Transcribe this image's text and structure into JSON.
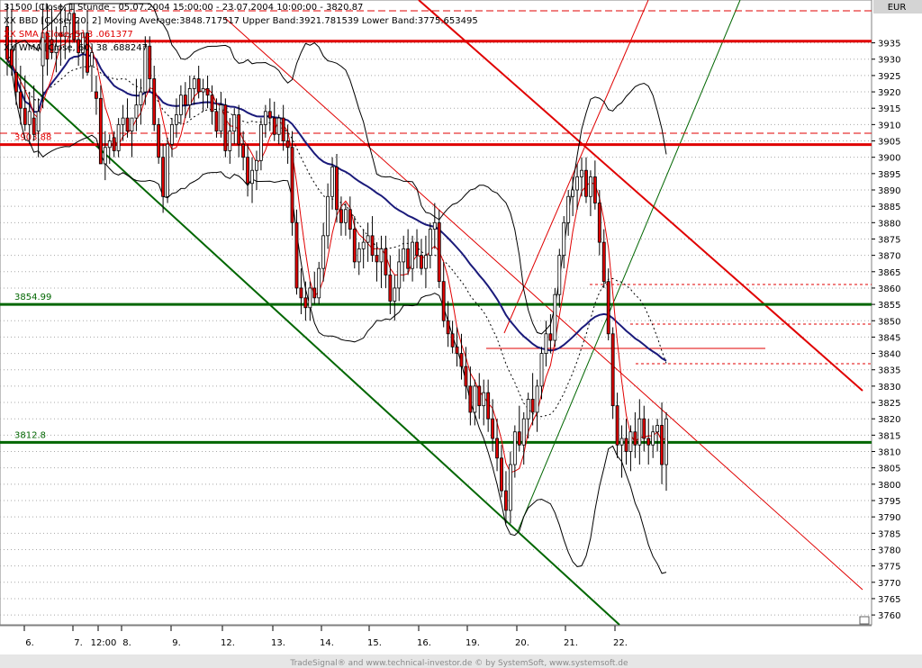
{
  "header": {
    "title_line": "31500 [Close, 1 Stunde - 05.07.2004 15:00:00 - 23.07.2004 10:00:00 - 3820.87",
    "currency": "EUR"
  },
  "legend": [
    {
      "text": "XX BBD [Close, 20, 2] Moving Average:3848.717517 Upper Band:3921.781539 Lower Band:3775.653495",
      "color": "#000000"
    },
    {
      "text": "XX SMA [Close, 5] 3 .061377",
      "color": "#e00000"
    },
    {
      "text": "XX WMA [Close, 60] 38 .688247",
      "color": "#000000"
    }
  ],
  "levels": [
    {
      "label": "3903.88",
      "value": 3903.88,
      "color": "#e00000"
    },
    {
      "label": "3854.99",
      "value": 3854.99,
      "color": "#006600"
    },
    {
      "label": "3812.8",
      "value": 3812.8,
      "color": "#006600"
    }
  ],
  "footer": "TradeSignal® and www.technical-investor.de © by SystemSoft, www.systemsoft.de",
  "colors": {
    "up": "#ffffff",
    "down": "#e00000",
    "support": "#006600",
    "resistance": "#e00000",
    "wma": "#1a1a7a"
  },
  "chart_data": {
    "type": "candlestick",
    "title": "31500 [Close, 1 Stunde - 05.07.2004 15:00:00 - 23.07.2004 10:00:00 - 3820.87",
    "ylim": [
      3757,
      3947
    ],
    "y_ticks": [
      3760,
      3765,
      3770,
      3775,
      3780,
      3785,
      3790,
      3795,
      3800,
      3805,
      3810,
      3815,
      3820,
      3825,
      3830,
      3835,
      3840,
      3845,
      3850,
      3855,
      3860,
      3865,
      3870,
      3875,
      3880,
      3885,
      3890,
      3895,
      3900,
      3905,
      3910,
      3915,
      3920,
      3925,
      3930,
      3935
    ],
    "x_labels": [
      "6.",
      "7.",
      "12:00",
      "8.",
      "9.",
      "12.",
      "13.",
      "14.",
      "15.",
      "16.",
      "19.",
      "20.",
      "21.",
      "22."
    ],
    "bars": 175,
    "ohlc": [
      [
        3940,
        3947,
        3925,
        3930
      ],
      [
        3933,
        3945,
        3925,
        3928
      ],
      [
        3926,
        3936,
        3916,
        3920
      ],
      [
        3920,
        3928,
        3910,
        3915
      ],
      [
        3915,
        3925,
        3908,
        3910
      ],
      [
        3910,
        3920,
        3904,
        3914
      ],
      [
        3912,
        3922,
        3905,
        3907
      ],
      [
        3908,
        3918,
        3900,
        3914
      ],
      [
        3928,
        3947,
        3915,
        3938
      ],
      [
        3938,
        3947,
        3925,
        3930
      ],
      [
        3936,
        3946,
        3930,
        3932
      ],
      [
        3932,
        3940,
        3926,
        3934
      ],
      [
        3938,
        3947,
        3928,
        3937
      ],
      [
        3937,
        3946,
        3930,
        3940
      ],
      [
        3942,
        3947,
        3932,
        3944
      ],
      [
        3944,
        3947,
        3935,
        3936
      ],
      [
        3936,
        3942,
        3928,
        3932
      ],
      [
        3932,
        3938,
        3924,
        3938
      ],
      [
        3938,
        3945,
        3925,
        3926
      ],
      [
        3928,
        3934,
        3920,
        3932
      ],
      [
        3920,
        3925,
        3913,
        3918
      ],
      [
        3918,
        3922,
        3898,
        3898
      ],
      [
        3898,
        3908,
        3893,
        3903
      ],
      [
        3903,
        3907,
        3898,
        3905
      ],
      [
        3906,
        3908,
        3900,
        3902
      ],
      [
        3902,
        3912,
        3900,
        3910
      ],
      [
        3910,
        3916,
        3905,
        3912
      ],
      [
        3912,
        3918,
        3906,
        3908
      ],
      [
        3908,
        3912,
        3900,
        3912
      ],
      [
        3912,
        3924,
        3908,
        3916
      ],
      [
        3916,
        3924,
        3910,
        3920
      ],
      [
        3920,
        3937,
        3916,
        3934
      ],
      [
        3934,
        3937,
        3920,
        3924
      ],
      [
        3924,
        3928,
        3908,
        3910
      ],
      [
        3910,
        3912,
        3898,
        3900
      ],
      [
        3900,
        3904,
        3883,
        3888
      ],
      [
        3888,
        3906,
        3886,
        3904
      ],
      [
        3904,
        3912,
        3900,
        3910
      ],
      [
        3910,
        3918,
        3906,
        3913
      ],
      [
        3913,
        3922,
        3910,
        3919
      ],
      [
        3919,
        3923,
        3912,
        3916
      ],
      [
        3916,
        3925,
        3912,
        3921
      ],
      [
        3921,
        3925,
        3916,
        3924
      ],
      [
        3924,
        3928,
        3918,
        3920
      ],
      [
        3920,
        3924,
        3914,
        3921
      ],
      [
        3921,
        3925,
        3915,
        3919
      ],
      [
        3919,
        3922,
        3910,
        3914
      ],
      [
        3914,
        3918,
        3906,
        3908
      ],
      [
        3908,
        3920,
        3906,
        3916
      ],
      [
        3916,
        3918,
        3900,
        3902
      ],
      [
        3902,
        3912,
        3898,
        3908
      ],
      [
        3908,
        3915,
        3904,
        3913
      ],
      [
        3913,
        3916,
        3900,
        3904
      ],
      [
        3904,
        3908,
        3896,
        3900
      ],
      [
        3900,
        3904,
        3888,
        3892
      ],
      [
        3892,
        3900,
        3886,
        3896
      ],
      [
        3896,
        3902,
        3890,
        3899
      ],
      [
        3899,
        3912,
        3896,
        3910
      ],
      [
        3910,
        3916,
        3906,
        3914
      ],
      [
        3914,
        3918,
        3908,
        3912
      ],
      [
        3912,
        3917,
        3905,
        3907
      ],
      [
        3907,
        3913,
        3904,
        3912
      ],
      [
        3912,
        3916,
        3902,
        3905
      ],
      [
        3905,
        3910,
        3898,
        3903
      ],
      [
        3903,
        3908,
        3876,
        3880
      ],
      [
        3880,
        3884,
        3858,
        3860
      ],
      [
        3860,
        3866,
        3852,
        3857
      ],
      [
        3857,
        3862,
        3850,
        3854
      ],
      [
        3854,
        3862,
        3850,
        3860
      ],
      [
        3860,
        3865,
        3855,
        3857
      ],
      [
        3857,
        3868,
        3855,
        3866
      ],
      [
        3866,
        3880,
        3862,
        3876
      ],
      [
        3876,
        3892,
        3872,
        3888
      ],
      [
        3888,
        3900,
        3884,
        3897
      ],
      [
        3897,
        3901,
        3880,
        3884
      ],
      [
        3884,
        3888,
        3876,
        3880
      ],
      [
        3880,
        3886,
        3876,
        3884
      ],
      [
        3884,
        3888,
        3875,
        3878
      ],
      [
        3878,
        3882,
        3866,
        3868
      ],
      [
        3868,
        3874,
        3864,
        3872
      ],
      [
        3872,
        3878,
        3866,
        3874
      ],
      [
        3874,
        3880,
        3868,
        3876
      ],
      [
        3876,
        3882,
        3868,
        3870
      ],
      [
        3870,
        3874,
        3862,
        3868
      ],
      [
        3868,
        3876,
        3860,
        3872
      ],
      [
        3872,
        3876,
        3860,
        3864
      ],
      [
        3864,
        3870,
        3852,
        3856
      ],
      [
        3856,
        3864,
        3850,
        3860
      ],
      [
        3860,
        3872,
        3856,
        3868
      ],
      [
        3868,
        3876,
        3862,
        3872
      ],
      [
        3872,
        3878,
        3864,
        3866
      ],
      [
        3866,
        3876,
        3862,
        3874
      ],
      [
        3874,
        3878,
        3866,
        3870
      ],
      [
        3870,
        3875,
        3864,
        3866
      ],
      [
        3866,
        3876,
        3860,
        3870
      ],
      [
        3870,
        3880,
        3866,
        3878
      ],
      [
        3878,
        3886,
        3872,
        3880
      ],
      [
        3880,
        3884,
        3860,
        3862
      ],
      [
        3862,
        3868,
        3848,
        3850
      ],
      [
        3850,
        3856,
        3842,
        3846
      ],
      [
        3846,
        3850,
        3840,
        3842
      ],
      [
        3842,
        3848,
        3836,
        3840
      ],
      [
        3840,
        3846,
        3832,
        3836
      ],
      [
        3836,
        3842,
        3826,
        3830
      ],
      [
        3830,
        3836,
        3818,
        3822
      ],
      [
        3822,
        3832,
        3818,
        3830
      ],
      [
        3830,
        3834,
        3820,
        3824
      ],
      [
        3824,
        3832,
        3818,
        3828
      ],
      [
        3828,
        3832,
        3816,
        3820
      ],
      [
        3820,
        3826,
        3810,
        3814
      ],
      [
        3814,
        3820,
        3804,
        3808
      ],
      [
        3808,
        3812,
        3796,
        3798
      ],
      [
        3798,
        3804,
        3788,
        3792
      ],
      [
        3792,
        3810,
        3788,
        3806
      ],
      [
        3806,
        3818,
        3802,
        3816
      ],
      [
        3816,
        3824,
        3810,
        3812
      ],
      [
        3812,
        3822,
        3806,
        3820
      ],
      [
        3820,
        3828,
        3814,
        3826
      ],
      [
        3826,
        3834,
        3818,
        3822
      ],
      [
        3822,
        3832,
        3816,
        3830
      ],
      [
        3830,
        3842,
        3826,
        3840
      ],
      [
        3840,
        3850,
        3836,
        3846
      ],
      [
        3846,
        3852,
        3840,
        3844
      ],
      [
        3844,
        3860,
        3842,
        3858
      ],
      [
        3858,
        3872,
        3854,
        3870
      ],
      [
        3870,
        3882,
        3866,
        3880
      ],
      [
        3880,
        3890,
        3876,
        3888
      ],
      [
        3888,
        3894,
        3882,
        3890
      ],
      [
        3890,
        3898,
        3884,
        3894
      ],
      [
        3894,
        3900,
        3888,
        3896
      ],
      [
        3896,
        3900,
        3886,
        3888
      ],
      [
        3888,
        3896,
        3882,
        3894
      ],
      [
        3894,
        3899,
        3884,
        3886
      ],
      [
        3886,
        3890,
        3870,
        3874
      ],
      [
        3874,
        3878,
        3860,
        3862
      ],
      [
        3862,
        3866,
        3844,
        3846
      ],
      [
        3846,
        3848,
        3820,
        3824
      ],
      [
        3824,
        3828,
        3808,
        3812
      ],
      [
        3812,
        3818,
        3802,
        3814
      ],
      [
        3814,
        3820,
        3806,
        3810
      ],
      [
        3810,
        3818,
        3804,
        3816
      ],
      [
        3816,
        3822,
        3808,
        3812
      ],
      [
        3812,
        3826,
        3806,
        3820
      ],
      [
        3820,
        3824,
        3810,
        3814
      ],
      [
        3814,
        3820,
        3806,
        3812
      ],
      [
        3812,
        3818,
        3808,
        3816
      ],
      [
        3816,
        3820,
        3810,
        3818
      ],
      [
        3818,
        3825,
        3800,
        3806
      ],
      [
        3806,
        3822,
        3798,
        3820
      ]
    ],
    "series": [
      {
        "name": "SMA [Close, 5]",
        "color": "#e00000"
      },
      {
        "name": "WMA [Close, 60]",
        "color": "#1a1a7a"
      },
      {
        "name": "BBD Upper Band",
        "color": "#000000"
      },
      {
        "name": "BBD Lower Band",
        "color": "#000000"
      },
      {
        "name": "BBD Moving Average",
        "color": "#000000"
      }
    ],
    "grid": true
  }
}
